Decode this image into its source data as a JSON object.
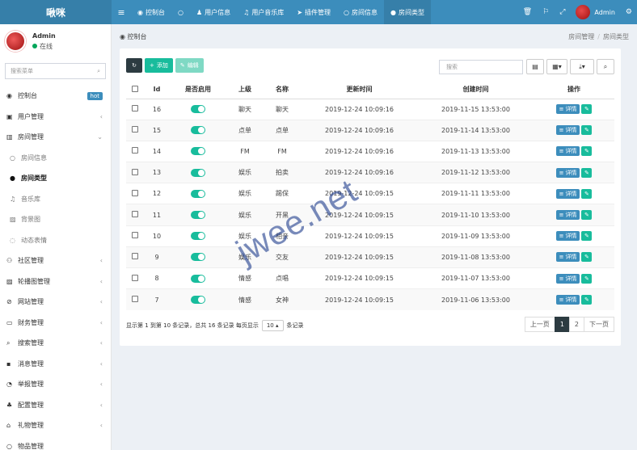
{
  "app": {
    "brand": "啾咪"
  },
  "topnav": {
    "tabs": [
      {
        "icon": "dashboard-icon",
        "glyph": "◉",
        "label": "控制台",
        "active": false
      },
      {
        "icon": "circle-icon",
        "glyph": "○",
        "label": "",
        "active": false
      },
      {
        "icon": "user-icon",
        "glyph": "♟",
        "label": "用户信息",
        "active": false
      },
      {
        "icon": "music-icon",
        "glyph": "♫",
        "label": "用户音乐库",
        "active": false
      },
      {
        "icon": "send-icon",
        "glyph": "➤",
        "label": "插件管理",
        "active": false
      },
      {
        "icon": "circle-icon",
        "glyph": "○",
        "label": "房间信息",
        "active": false
      },
      {
        "icon": "dot-icon",
        "glyph": "●",
        "label": "房间类型",
        "active": true
      }
    ],
    "user": "Admin"
  },
  "sidebar": {
    "user_name": "Admin",
    "user_status": "在线",
    "search_placeholder": "搜索菜单",
    "items": [
      {
        "glyph": "◉",
        "icon": "dashboard-icon",
        "label": "控制台",
        "badge": "hot",
        "sub": false
      },
      {
        "glyph": "▣",
        "icon": "user-icon",
        "label": "用户管理",
        "chevron": "‹",
        "sub": false
      },
      {
        "glyph": "▥",
        "icon": "bank-icon",
        "label": "房间管理",
        "chevron": "⌄",
        "sub": false
      },
      {
        "glyph": "○",
        "icon": "circle-icon",
        "label": "房间信息",
        "sub": true
      },
      {
        "glyph": "●",
        "icon": "dot-icon",
        "label": "房间类型",
        "sub": true,
        "active": true
      },
      {
        "glyph": "♫",
        "icon": "music-icon",
        "label": "音乐库",
        "sub": true
      },
      {
        "glyph": "▨",
        "icon": "image-icon",
        "label": "背景图",
        "sub": true
      },
      {
        "glyph": "◌",
        "icon": "emoji-icon",
        "label": "动态表情",
        "sub": true
      },
      {
        "glyph": "⚇",
        "icon": "community-icon",
        "label": "社区管理",
        "chevron": "‹",
        "sub": false
      },
      {
        "glyph": "▨",
        "icon": "carousel-icon",
        "label": "轮播图管理",
        "chevron": "‹",
        "sub": false
      },
      {
        "glyph": "⊘",
        "icon": "website-icon",
        "label": "网站管理",
        "chevron": "‹",
        "sub": false
      },
      {
        "glyph": "▭",
        "icon": "finance-icon",
        "label": "财务管理",
        "chevron": "‹",
        "sub": false
      },
      {
        "glyph": "⌕",
        "icon": "search-icon",
        "label": "搜索管理",
        "chevron": "‹",
        "sub": false
      },
      {
        "glyph": "▪",
        "icon": "message-icon",
        "label": "消息管理",
        "chevron": "‹",
        "sub": false
      },
      {
        "glyph": "◔",
        "icon": "report-icon",
        "label": "举报管理",
        "chevron": "‹",
        "sub": false
      },
      {
        "glyph": "♣",
        "icon": "config-icon",
        "label": "配置管理",
        "chevron": "‹",
        "sub": false
      },
      {
        "glyph": "⌂",
        "icon": "gift-icon",
        "label": "礼物管理",
        "chevron": "‹",
        "sub": false
      },
      {
        "glyph": "○",
        "icon": "item-icon",
        "label": "物品管理",
        "chevron": "",
        "sub": false
      }
    ]
  },
  "header": {
    "title": "控制台",
    "breadcrumb": [
      "房间管理",
      "房间类型"
    ]
  },
  "toolbar": {
    "add_label": "添加",
    "edit_label": "编辑",
    "search_placeholder": "搜索"
  },
  "table": {
    "columns": [
      "Id",
      "是否启用",
      "上级",
      "名称",
      "更新时间",
      "创建时间",
      "操作"
    ],
    "detail_label": "详情",
    "rows": [
      {
        "id": "16",
        "parent": "聊天",
        "name": "聊天",
        "updated": "2019-12-24 10:09:16",
        "created": "2019-11-15 13:53:00"
      },
      {
        "id": "15",
        "parent": "点单",
        "name": "点单",
        "updated": "2019-12-24 10:09:16",
        "created": "2019-11-14 13:53:00"
      },
      {
        "id": "14",
        "parent": "FM",
        "name": "FM",
        "updated": "2019-12-24 10:09:16",
        "created": "2019-11-13 13:53:00"
      },
      {
        "id": "13",
        "parent": "娱乐",
        "name": "拍卖",
        "updated": "2019-12-24 10:09:16",
        "created": "2019-11-12 13:53:00"
      },
      {
        "id": "12",
        "parent": "娱乐",
        "name": "踢保",
        "updated": "2019-12-24 10:09:15",
        "created": "2019-11-11 13:53:00"
      },
      {
        "id": "11",
        "parent": "娱乐",
        "name": "开黑",
        "updated": "2019-12-24 10:09:15",
        "created": "2019-11-10 13:53:00"
      },
      {
        "id": "10",
        "parent": "娱乐",
        "name": "相亲",
        "updated": "2019-12-24 10:09:15",
        "created": "2019-11-09 13:53:00"
      },
      {
        "id": "9",
        "parent": "娱乐",
        "name": "交友",
        "updated": "2019-12-24 10:09:15",
        "created": "2019-11-08 13:53:00"
      },
      {
        "id": "8",
        "parent": "情感",
        "name": "点唱",
        "updated": "2019-12-24 10:09:15",
        "created": "2019-11-07 13:53:00"
      },
      {
        "id": "7",
        "parent": "情感",
        "name": "女神",
        "updated": "2019-12-24 10:09:15",
        "created": "2019-11-06 13:53:00"
      }
    ]
  },
  "pagination": {
    "info_prefix": "显示第 1 到第 10 条记录，总共 16 条记录 每页显示",
    "page_size": "10",
    "info_suffix": "条记录",
    "prev": "上一页",
    "pages": [
      "1",
      "2"
    ],
    "next": "下一页"
  },
  "watermark": "jwee.net"
}
